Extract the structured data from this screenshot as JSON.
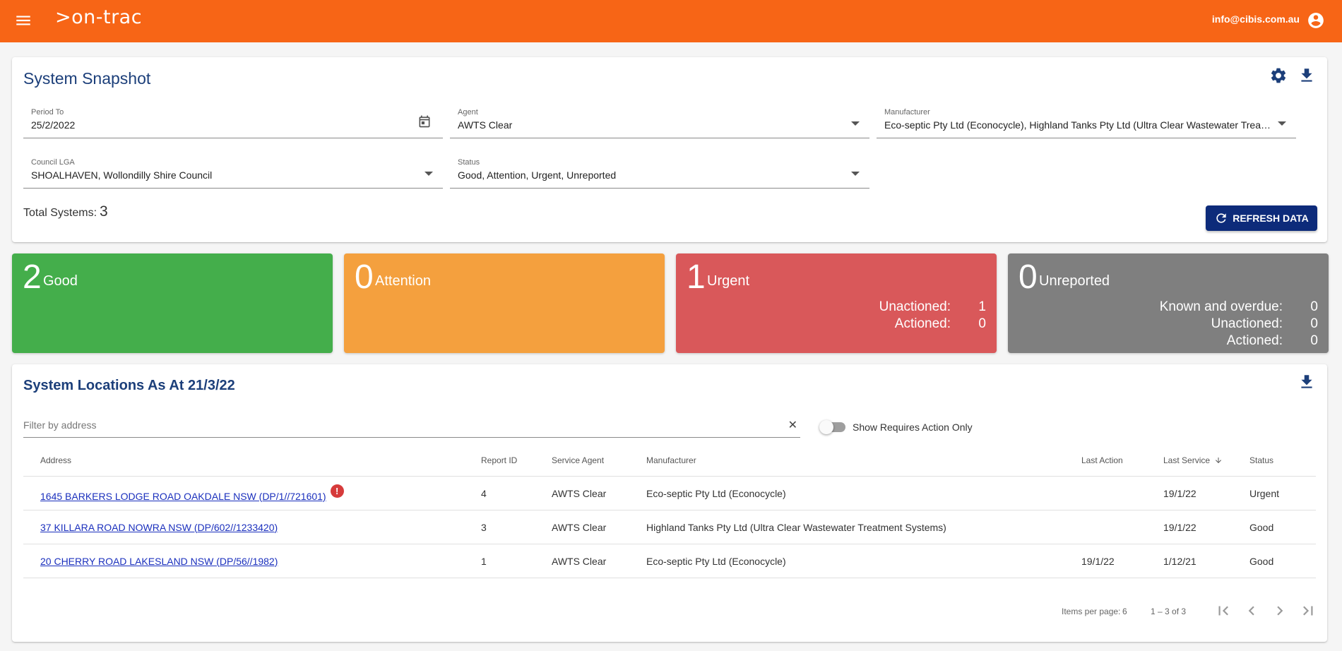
{
  "header": {
    "logo": ">on-trac",
    "user_email": "info@cibis.com.au"
  },
  "snapshot": {
    "title": "System Snapshot",
    "period": {
      "label": "Period To",
      "value": "25/2/2022"
    },
    "agent": {
      "label": "Agent",
      "value": "AWTS Clear"
    },
    "manufacturer": {
      "label": "Manufacturer",
      "value": "Eco-septic Pty Ltd (Econocycle), Highland Tanks Pty Ltd (Ultra Clear Wastewater Treatm..."
    },
    "council": {
      "label": "Council LGA",
      "value": "SHOALHAVEN, Wollondilly Shire Council"
    },
    "status": {
      "label": "Status",
      "value": "Good, Attention, Urgent, Unreported"
    },
    "total_label": "Total Systems:",
    "total_value": "3",
    "refresh_label": "REFRESH DATA"
  },
  "tiles": {
    "good": {
      "count": "2",
      "label": "Good"
    },
    "attention": {
      "count": "0",
      "label": "Attention"
    },
    "urgent": {
      "count": "1",
      "label": "Urgent",
      "unactioned_label": "Unactioned:",
      "unactioned_value": "1",
      "actioned_label": "Actioned:",
      "actioned_value": "0"
    },
    "unreported": {
      "count": "0",
      "label": "Unreported",
      "overdue_label": "Known and overdue:",
      "overdue_value": "0",
      "unactioned_label": "Unactioned:",
      "unactioned_value": "0",
      "actioned_label": "Actioned:",
      "actioned_value": "0"
    }
  },
  "locations": {
    "title": "System Locations As At 21/3/22",
    "filter_placeholder": "Filter by address",
    "filter_value": "",
    "clear_symbol": "✕",
    "toggle_label": "Show Requires Action Only",
    "columns": {
      "address": "Address",
      "report_id": "Report ID",
      "service_agent": "Service Agent",
      "manufacturer": "Manufacturer",
      "last_action": "Last Action",
      "last_service": "Last Service",
      "status": "Status"
    },
    "rows": [
      {
        "address": "1645 BARKERS LODGE ROAD OAKDALE NSW (DP/1//721601)",
        "alert": "!",
        "report_id": "4",
        "service_agent": "AWTS Clear",
        "manufacturer": "Eco-septic Pty Ltd (Econocycle)",
        "last_action": "",
        "last_service": "19/1/22",
        "status": "Urgent"
      },
      {
        "address": "37 KILLARA ROAD NOWRA NSW (DP/602//1233420)",
        "alert": "",
        "report_id": "3",
        "service_agent": "AWTS Clear",
        "manufacturer": "Highland Tanks Pty Ltd (Ultra Clear Wastewater Treatment Systems)",
        "last_action": "",
        "last_service": "19/1/22",
        "status": "Good"
      },
      {
        "address": "20 CHERRY ROAD LAKESLAND NSW (DP/56//1982)",
        "alert": "",
        "report_id": "1",
        "service_agent": "AWTS Clear",
        "manufacturer": "Eco-septic Pty Ltd (Econocycle)",
        "last_action": "19/1/22",
        "last_service": "1/12/21",
        "status": "Good"
      }
    ],
    "paginator": {
      "items_label": "Items per page:",
      "page_size": "6",
      "range": "1 – 3 of 3"
    }
  }
}
